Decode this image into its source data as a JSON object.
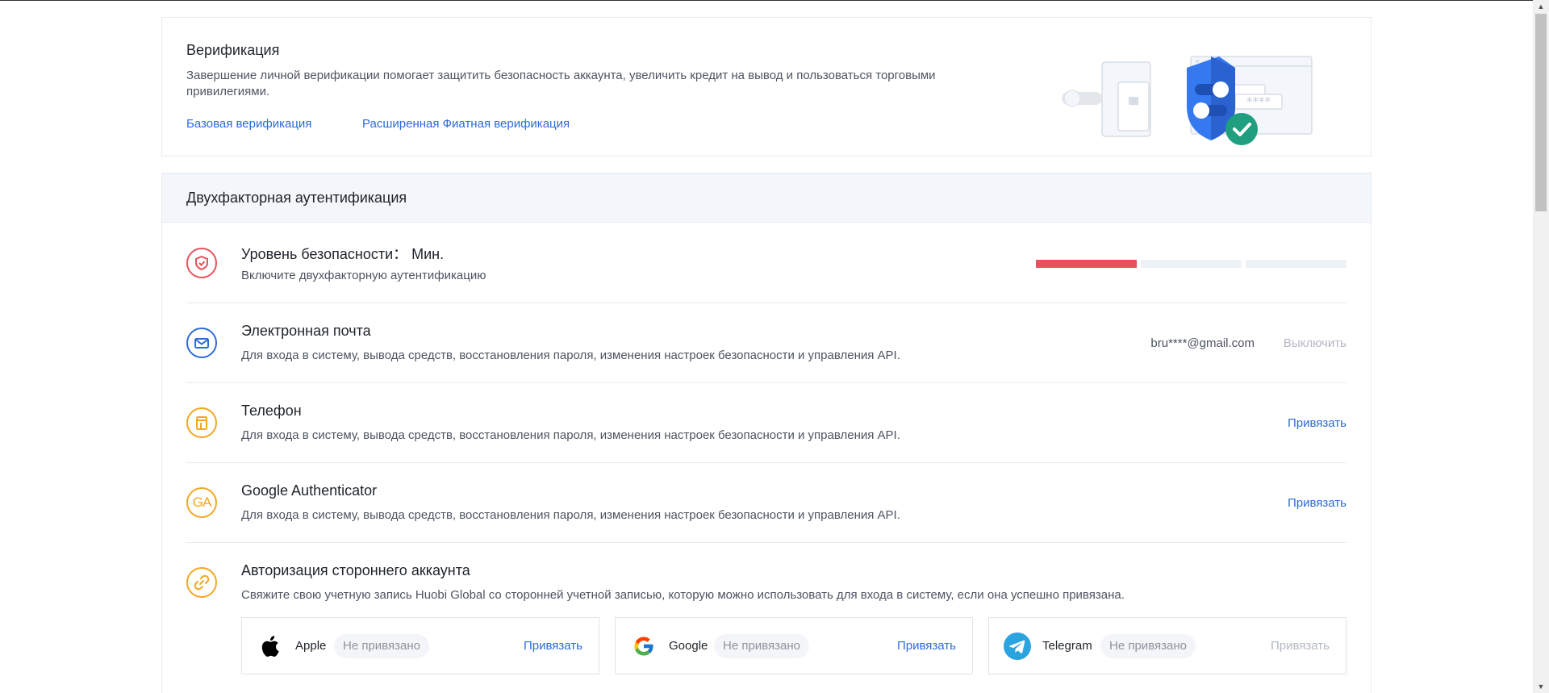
{
  "verification": {
    "title": "Верификация",
    "description": "Завершение личной верификации помогает защитить безопасность аккаунта, увеличить кредит на вывод и пользоваться торговыми привилегиями.",
    "basic_link": "Базовая верификация",
    "advanced_link": "Расширенная Фиатная верификация",
    "illustration_password": "****"
  },
  "two_factor": {
    "title": "Двухфакторная аутентификация",
    "security_level": {
      "title": "Уровень безопасности：  Мин.",
      "description": "Включите двухфакторную аутентификацию",
      "icon": "shield-icon",
      "level": 1,
      "max_level": 3,
      "color": "#e8525c"
    },
    "email": {
      "title": "Электронная почта",
      "description": "Для входа в систему, вывода средств, восстановления пароля, изменения настроек безопасности и управления API.",
      "value": "bru****@gmail.com",
      "action": "Выключить",
      "icon": "mail-icon",
      "color": "#2d6bd8"
    },
    "phone": {
      "title": "Телефон",
      "description": "Для входа в систему, вывода средств, восстановления пароля, изменения настроек безопасности и управления API.",
      "action": "Привязать",
      "icon": "phone-icon",
      "color": "#f5a623"
    },
    "google_auth": {
      "title": "Google Authenticator",
      "description": "Для входа в систему, вывода средств, восстановления пароля, изменения настроек безопасности и управления API.",
      "action": "Привязать",
      "icon_text": "GA",
      "icon": "google-authenticator-icon",
      "color": "#f5a623"
    },
    "third_party": {
      "title": "Авторизация стороннего аккаунта",
      "description": "Свяжите свою учетную запись Huobi Global со сторонней учетной записью, которую можно использовать для входа в систему, если она успешно привязана.",
      "icon": "link-icon",
      "color": "#f5a623",
      "providers": [
        {
          "name": "Apple",
          "status": "Не привязано",
          "action": "Привязать",
          "icon": "apple-icon"
        },
        {
          "name": "Google",
          "status": "Не привязано",
          "action": "Привязать",
          "icon": "google-icon"
        },
        {
          "name": "Telegram",
          "status": "Не привязано",
          "action": "Привязать",
          "icon": "telegram-icon"
        }
      ]
    }
  },
  "colors": {
    "link": "#2d6bd8",
    "disabled": "#b3b8c2",
    "danger": "#e8525c",
    "warning": "#f5a623"
  }
}
